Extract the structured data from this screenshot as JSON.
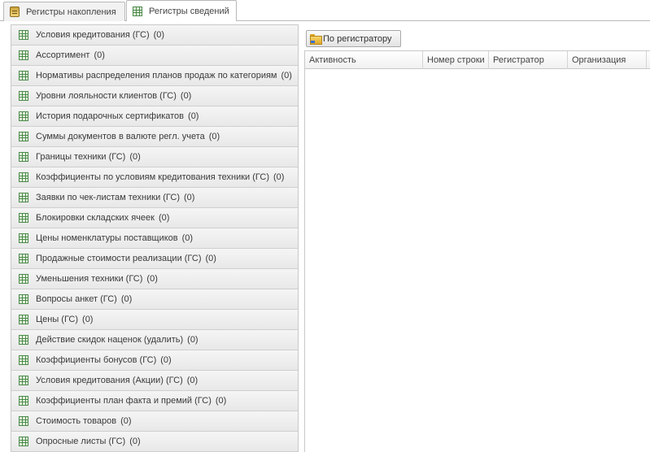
{
  "tabs": [
    {
      "label": "Регистры накопления",
      "icon": "accumulation-register-icon"
    },
    {
      "label": "Регистры сведений",
      "icon": "info-register-icon",
      "active": true
    }
  ],
  "registers": [
    {
      "name": "Условия кредитования (ГС)",
      "count": "(0)"
    },
    {
      "name": "Ассортимент",
      "count": "(0)"
    },
    {
      "name": "Нормативы распределения планов продаж по категориям",
      "count": "(0)"
    },
    {
      "name": "Уровни лояльности клиентов (ГС)",
      "count": "(0)"
    },
    {
      "name": "История подарочных сертификатов",
      "count": "(0)"
    },
    {
      "name": "Суммы документов в валюте регл. учета",
      "count": "(0)"
    },
    {
      "name": "Границы техники (ГС)",
      "count": "(0)"
    },
    {
      "name": "Коэффициенты по условиям кредитования техники (ГС)",
      "count": "(0)"
    },
    {
      "name": "Заявки по чек-листам техники (ГС)",
      "count": "(0)"
    },
    {
      "name": "Блокировки складских ячеек",
      "count": "(0)"
    },
    {
      "name": "Цены номенклатуры поставщиков",
      "count": "(0)"
    },
    {
      "name": "Продажные стоимости реализации (ГС)",
      "count": "(0)"
    },
    {
      "name": "Уменьшения техники (ГС)",
      "count": "(0)"
    },
    {
      "name": "Вопросы анкет (ГС)",
      "count": "(0)"
    },
    {
      "name": "Цены (ГС)",
      "count": "(0)"
    },
    {
      "name": "Действие скидок наценок (удалить)",
      "count": "(0)"
    },
    {
      "name": "Коэффициенты бонусов (ГС)",
      "count": "(0)"
    },
    {
      "name": "Условия кредитования (Акции) (ГС)",
      "count": "(0)"
    },
    {
      "name": "Коэффициенты план факта и премий (ГС)",
      "count": "(0)"
    },
    {
      "name": "Стоимость товаров",
      "count": "(0)"
    },
    {
      "name": "Опросные листы (ГС)",
      "count": "(0)"
    }
  ],
  "toolbar": {
    "by_registrar_label": "По регистратору"
  },
  "grid": {
    "columns": [
      "Активность",
      "Номер строки",
      "Регистратор",
      "Организация"
    ]
  }
}
